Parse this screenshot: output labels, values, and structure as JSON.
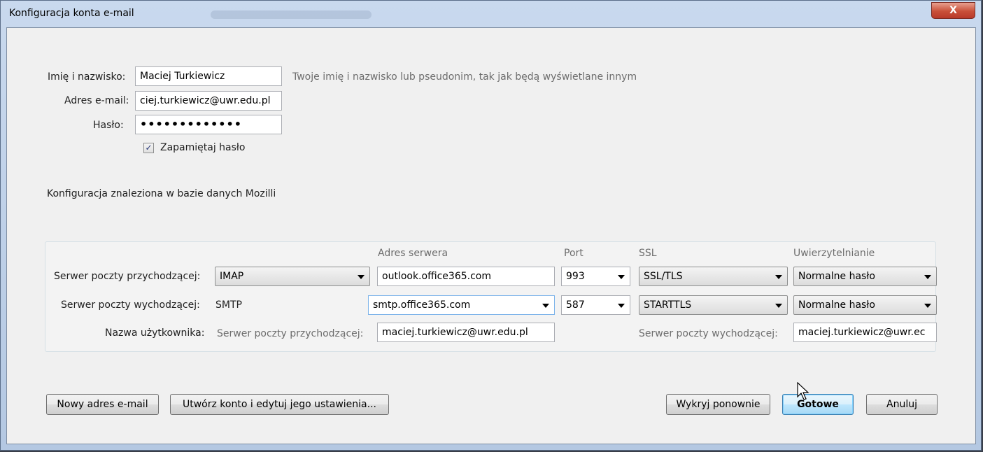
{
  "window": {
    "title": "Konfiguracja konta e-mail",
    "close_label": "X"
  },
  "identity": {
    "name_label": "Imię i nazwisko:",
    "name_value": "Maciej Turkiewicz",
    "name_hint": "Twoje imię i nazwisko lub pseudonim, tak jak będą wyświetlane innym",
    "email_label": "Adres e-mail:",
    "email_value": "ciej.turkiewicz@uwr.edu.pl",
    "password_label": "Hasło:",
    "password_value": "•••••••••••••",
    "remember_label": "Zapamiętaj hasło",
    "remember_checked": "✓"
  },
  "status_text": "Konfiguracja znaleziona w bazie danych Mozilli",
  "server_table": {
    "headers": {
      "address": "Adres serwera",
      "port": "Port",
      "ssl": "SSL",
      "auth": "Uwierzytelnianie"
    },
    "incoming": {
      "label": "Serwer poczty przychodzącej:",
      "protocol": "IMAP",
      "address": "outlook.office365.com",
      "port": "993",
      "ssl": "SSL/TLS",
      "auth": "Normalne hasło"
    },
    "outgoing": {
      "label": "Serwer poczty wychodzącej:",
      "protocol": "SMTP",
      "address": "smtp.office365.com",
      "port": "587",
      "ssl": "STARTTLS",
      "auth": "Normalne hasło"
    },
    "username": {
      "label": "Nazwa użytkownika:",
      "incoming_label": "Serwer poczty przychodzącej:",
      "incoming_value": "maciej.turkiewicz@uwr.edu.pl",
      "outgoing_label": "Serwer poczty wychodzącej:",
      "outgoing_value": "maciej.turkiewicz@uwr.ec"
    }
  },
  "buttons": {
    "new_email": "Nowy adres e-mail",
    "create_edit": "Utwórz konto i edytuj jego ustawienia...",
    "redetect": "Wykryj ponownie",
    "done": "Gotowe",
    "cancel": "Anuluj"
  }
}
